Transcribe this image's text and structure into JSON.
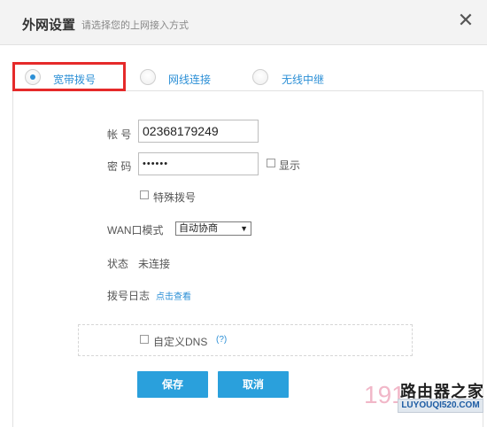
{
  "dialog": {
    "title": "外网设置",
    "subtitle": "请选择您的上网接入方式",
    "close": "✕"
  },
  "tabs": [
    {
      "label": "宽带拨号",
      "checked": true
    },
    {
      "label": "网线连接",
      "checked": false
    },
    {
      "label": "无线中继",
      "checked": false
    }
  ],
  "form": {
    "account_label": "帐 号",
    "account_value": "02368179249",
    "password_label": "密 码",
    "password_value": "••••••",
    "show_label": "显示",
    "special_dial_label": "特殊拨号",
    "wan_mode_label": "WAN口模式",
    "wan_mode_value": "自动协商",
    "status_label": "状态",
    "status_value": "未连接",
    "dial_log_label": "拨号日志",
    "dial_log_link": "点击查看",
    "custom_dns_label": "自定义DNS",
    "dns_help": "(?)"
  },
  "buttons": {
    "save": "保存",
    "cancel": "取消"
  },
  "watermark": {
    "number": "191",
    "site_name": "路由器之家",
    "url": "LUYOUQI520.COM"
  },
  "colors": {
    "accent": "#2b8fd6",
    "button": "#2aa0dc",
    "highlight_box": "#e52a2a"
  }
}
